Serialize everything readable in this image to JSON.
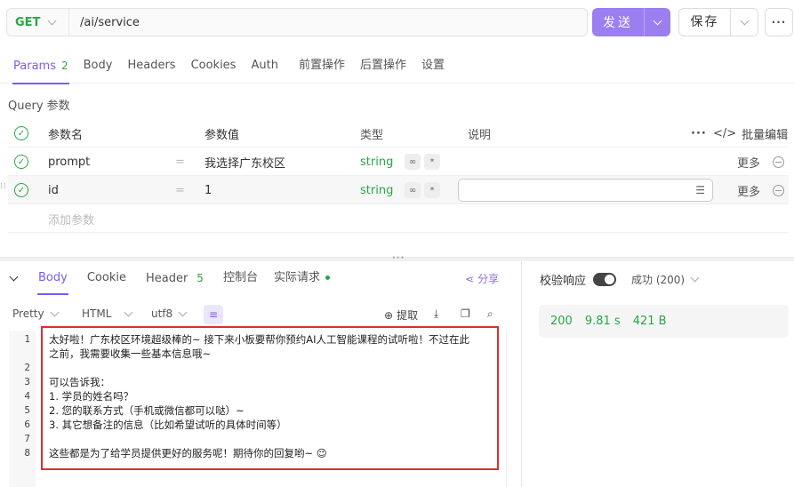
{
  "request": {
    "method": "GET",
    "url": "/ai/service",
    "send_label": "发送",
    "save_label": "保存",
    "more_label": "···"
  },
  "tabs": [
    {
      "label": "Params",
      "count": "2"
    },
    {
      "label": "Body"
    },
    {
      "label": "Headers"
    },
    {
      "label": "Cookies"
    },
    {
      "label": "Auth"
    },
    {
      "label": "前置操作"
    },
    {
      "label": "后置操作"
    },
    {
      "label": "设置"
    }
  ],
  "query": {
    "title": "Query 参数",
    "headers": {
      "name": "参数名",
      "value": "参数值",
      "type": "类型",
      "desc": "说明",
      "ellipsis": "···",
      "bulk": "批量编辑"
    },
    "rows": [
      {
        "name": "prompt",
        "eq": "=",
        "value": "我选择广东校区",
        "type": "string",
        "more": "更多"
      },
      {
        "name": "id",
        "eq": "=",
        "value": "1",
        "type": "string",
        "more": "更多"
      }
    ],
    "add_placeholder": "添加参数"
  },
  "response": {
    "tabs": [
      {
        "label": "Body"
      },
      {
        "label": "Cookie"
      },
      {
        "label": "Header",
        "count": "5"
      },
      {
        "label": "控制台"
      },
      {
        "label": "实际请求"
      }
    ],
    "share_label": "分享",
    "format": "Pretty",
    "lang": "HTML",
    "encoding": "utf8",
    "extract_label": "提取",
    "lines": [
      {
        "n": "1",
        "text": "太好啦！广东校区环境超级棒的~ 接下来小板要帮你预约AI人工智能课程的试听啦！不过在此"
      },
      {
        "n": "",
        "text": "之前，我需要收集一些基本信息哦~"
      },
      {
        "n": "2",
        "text": ""
      },
      {
        "n": "3",
        "text": "可以告诉我："
      },
      {
        "n": "4",
        "text": "1. 学员的姓名吗？"
      },
      {
        "n": "5",
        "text": "2. 您的联系方式（手机或微信都可以哒）~"
      },
      {
        "n": "6",
        "text": "3. 其它想备注的信息（比如希望试听的具体时间等）"
      },
      {
        "n": "7",
        "text": ""
      },
      {
        "n": "8",
        "text": "这些都是为了给学员提供更好的服务呢！期待你的回复哟~ 😉"
      }
    ]
  },
  "verify": {
    "label": "校验响应",
    "status_select": "成功 (200)",
    "status_code": "200",
    "time": "9.81 s",
    "size": "421 B"
  },
  "colors": {
    "accent": "#7b5cf0",
    "send": "#9b7ef0",
    "success": "#28a745",
    "highlight": "#d93030"
  }
}
